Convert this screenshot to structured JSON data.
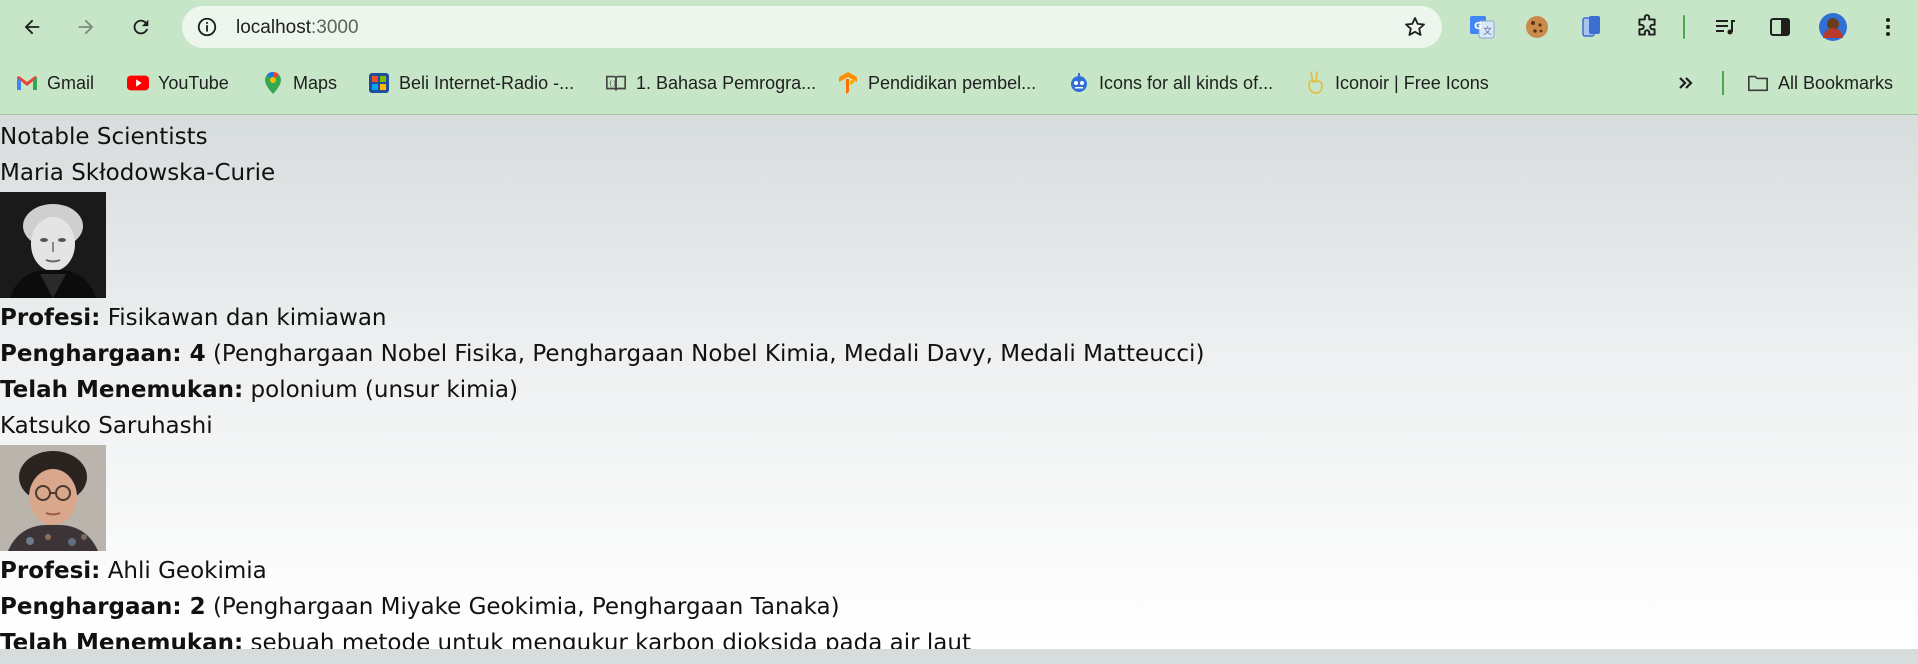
{
  "browser": {
    "url_host": "localhost",
    "url_port": ":3000",
    "bookmarks": [
      {
        "label": "Gmail",
        "icon": "gmail-icon"
      },
      {
        "label": "YouTube",
        "icon": "youtube-icon"
      },
      {
        "label": "Maps",
        "icon": "maps-icon"
      },
      {
        "label": "Beli Internet-Radio -...",
        "icon": "radio-store-icon"
      },
      {
        "label": "1. Bahasa Pemrogra...",
        "icon": "book-icon"
      },
      {
        "label": "Pendidikan pembel...",
        "icon": "tensorflow-icon"
      },
      {
        "label": "Icons for all kinds of...",
        "icon": "robot-icon"
      },
      {
        "label": "Iconoir | Free Icons",
        "icon": "peace-hand-icon"
      }
    ],
    "all_bookmarks_label": "All Bookmarks"
  },
  "page": {
    "heading": "Notable Scientists",
    "scientists": [
      {
        "name": "Maria Skłodowska-Curie",
        "photo_icon": "portrait-photo",
        "profession_label": "Profesi:",
        "profession": "Fisikawan dan kimiawan",
        "awards_label": "Penghargaan: 4",
        "awards": "(Penghargaan Nobel Fisika, Penghargaan Nobel Kimia, Medali Davy, Medali Matteucci)",
        "discovered_label": "Telah Menemukan:",
        "discovered": "polonium (unsur kimia)"
      },
      {
        "name": "Katsuko Saruhashi",
        "photo_icon": "portrait-photo",
        "profession_label": "Profesi:",
        "profession": "Ahli Geokimia",
        "awards_label": "Penghargaan: 2",
        "awards": "(Penghargaan Miyake Geokimia, Penghargaan Tanaka)",
        "discovered_label": "Telah Menemukan:",
        "discovered": "sebuah metode untuk mengukur karbon dioksida pada air laut"
      }
    ]
  }
}
